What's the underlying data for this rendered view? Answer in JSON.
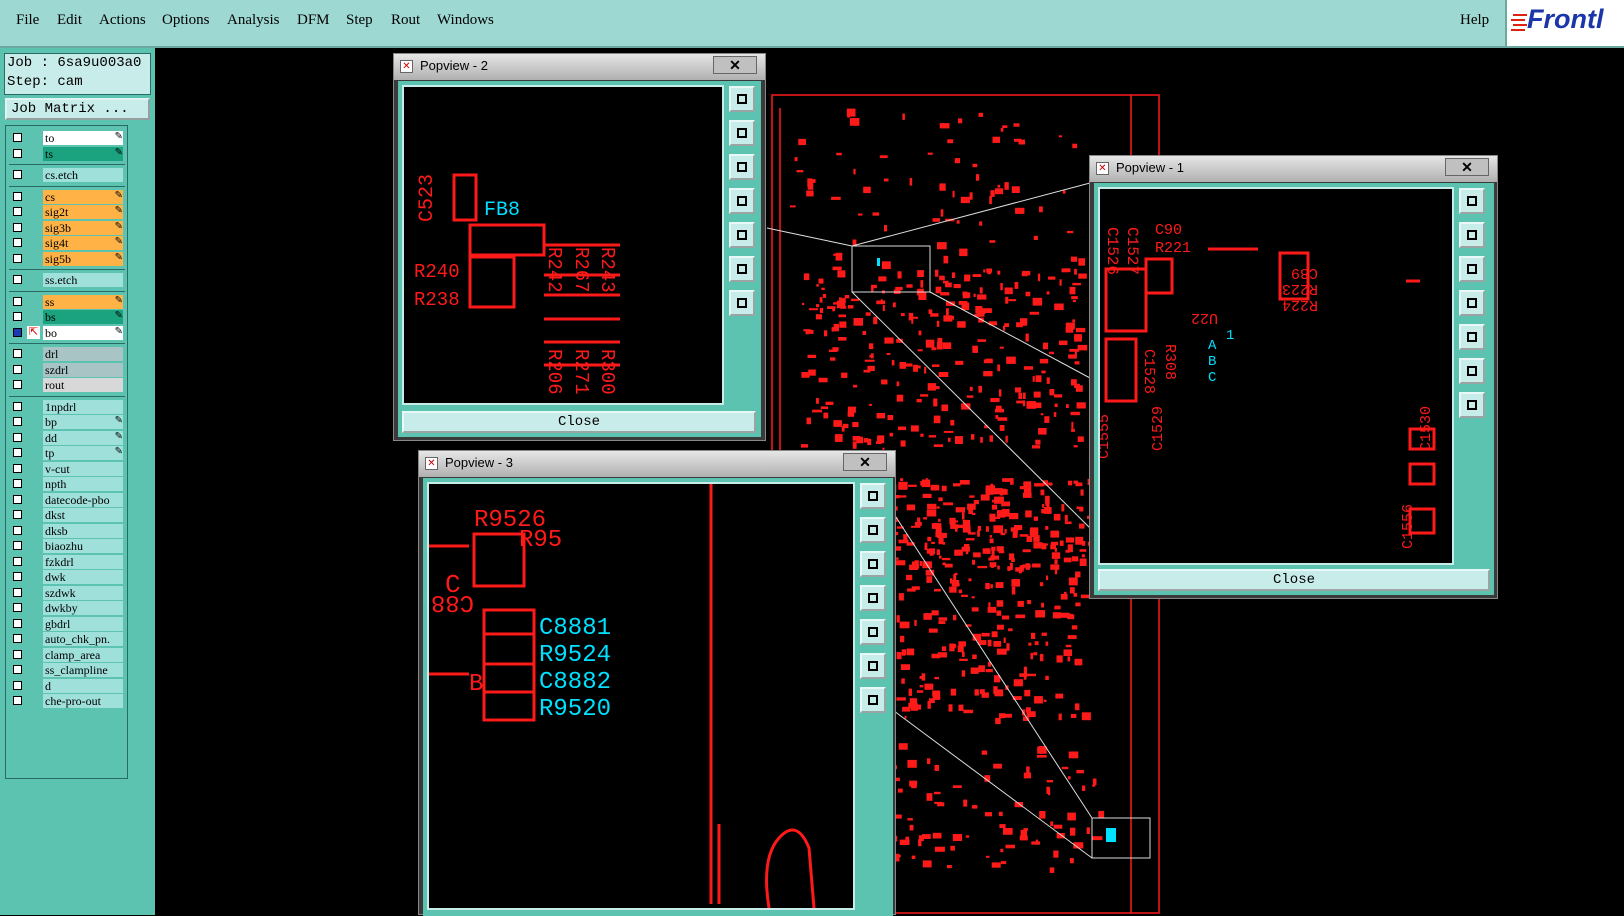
{
  "menu": {
    "file": "File",
    "edit": "Edit",
    "actions": "Actions",
    "options": "Options",
    "analysis": "Analysis",
    "dfm": "DFM",
    "step": "Step",
    "rout": "Rout",
    "windows": "Windows",
    "help": "Help"
  },
  "logo": {
    "text": "Frontl"
  },
  "job": {
    "job_line": "Job : 6sa9u003a0",
    "step_line": "Step: cam",
    "matrix_button": "Job Matrix ..."
  },
  "layers": [
    {
      "name": "to",
      "color": "#ffffff",
      "flag": "✎"
    },
    {
      "name": "ts",
      "color": "#1aa37e",
      "flag": "✎"
    },
    {
      "name": "cs.etch",
      "color": "#9fe0da",
      "flag": ""
    },
    {
      "name": "cs",
      "color": "#ffb347",
      "flag": "✎"
    },
    {
      "name": "sig2t",
      "color": "#ffb347",
      "flag": "✎"
    },
    {
      "name": "sig3b",
      "color": "#ffb347",
      "flag": "✎"
    },
    {
      "name": "sig4t",
      "color": "#ffb347",
      "flag": "✎"
    },
    {
      "name": "sig5b",
      "color": "#ffb347",
      "flag": "✎"
    },
    {
      "name": "ss.etch",
      "color": "#9fe0da",
      "flag": ""
    },
    {
      "name": "ss",
      "color": "#ffb347",
      "flag": "✎"
    },
    {
      "name": "bs",
      "color": "#1aa37e",
      "flag": "✎"
    },
    {
      "name": "bo",
      "color": "#ffffff",
      "flag": "✎"
    },
    {
      "name": "drl",
      "color": "#a8c4c4",
      "flag": ""
    },
    {
      "name": "szdrl",
      "color": "#a8c4c4",
      "flag": ""
    },
    {
      "name": "rout",
      "color": "#d8d8d8",
      "flag": ""
    },
    {
      "name": "1npdrl",
      "color": "#9fe0da",
      "flag": ""
    },
    {
      "name": "bp",
      "color": "#9fe0da",
      "flag": "✎"
    },
    {
      "name": "dd",
      "color": "#9fe0da",
      "flag": "✎"
    },
    {
      "name": "tp",
      "color": "#9fe0da",
      "flag": "✎"
    },
    {
      "name": "v-cut",
      "color": "#9fe0da",
      "flag": ""
    },
    {
      "name": "npth",
      "color": "#9fe0da",
      "flag": ""
    },
    {
      "name": "datecode-pbo",
      "color": "#9fe0da",
      "flag": ""
    },
    {
      "name": "dkst",
      "color": "#9fe0da",
      "flag": ""
    },
    {
      "name": "dksb",
      "color": "#9fe0da",
      "flag": ""
    },
    {
      "name": "biaozhu",
      "color": "#9fe0da",
      "flag": ""
    },
    {
      "name": "fzkdrl",
      "color": "#9fe0da",
      "flag": ""
    },
    {
      "name": "dwk",
      "color": "#9fe0da",
      "flag": ""
    },
    {
      "name": "szdwk",
      "color": "#9fe0da",
      "flag": ""
    },
    {
      "name": "dwkby",
      "color": "#9fe0da",
      "flag": ""
    },
    {
      "name": "gbdrl",
      "color": "#9fe0da",
      "flag": ""
    },
    {
      "name": "auto_chk_pn.",
      "color": "#9fe0da",
      "flag": ""
    },
    {
      "name": "clamp_area",
      "color": "#9fe0da",
      "flag": ""
    },
    {
      "name": "ss_clampline",
      "color": "#9fe0da",
      "flag": ""
    },
    {
      "name": "d",
      "color": "#9fe0da",
      "flag": ""
    },
    {
      "name": "che-pro-out",
      "color": "#9fe0da",
      "flag": ""
    }
  ],
  "popview1": {
    "title": "Popview - 1",
    "close": "Close",
    "close_x": "✕",
    "labels": [
      "C1526",
      "C1527",
      "C90",
      "R221",
      "C89",
      "R223",
      "R224",
      "U22",
      "R308",
      "C1528",
      "C1529",
      "C1529",
      "C1555",
      "C1556",
      "C1530"
    ],
    "cyan_labels": [
      "A",
      "B",
      "C",
      "1"
    ]
  },
  "popview2": {
    "title": "Popview - 2",
    "close": "Close",
    "close_x": "✕",
    "labels": [
      "C523",
      "FB8",
      "R242",
      "R267",
      "R243",
      "R240",
      "R238",
      "R206",
      "R271",
      "R300"
    ]
  },
  "popview3": {
    "title": "Popview - 3",
    "close": "Close",
    "close_x": "✕",
    "labels": [
      "R9526",
      "R95",
      "C8883",
      "C8881",
      "R9524",
      "C8882",
      "R9520",
      "C",
      "B"
    ]
  },
  "colors": {
    "trace": "#ff1a1a",
    "highlight": "#00e0ff",
    "panel": "#5cc3b0",
    "menubar": "#9ed8d2"
  }
}
